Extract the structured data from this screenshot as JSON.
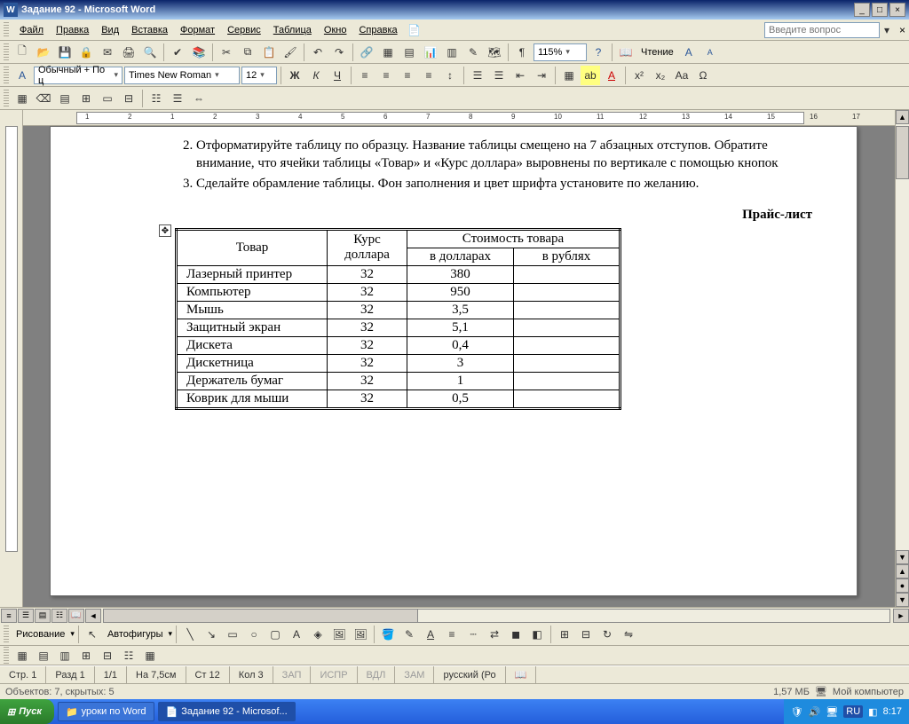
{
  "window": {
    "title": "Задание 92 - Microsoft Word"
  },
  "menu": {
    "items": [
      "Файл",
      "Правка",
      "Вид",
      "Вставка",
      "Формат",
      "Сервис",
      "Таблица",
      "Окно",
      "Справка"
    ],
    "help_placeholder": "Введите вопрос"
  },
  "formatting": {
    "style": "Обычный + По ц",
    "font": "Times New Roman",
    "size": "12",
    "zoom": "115%",
    "reading": "Чтение"
  },
  "drawing": {
    "label": "Рисование",
    "autoshapes": "Автофигуры"
  },
  "ruler_ticks": [
    "1",
    "2",
    "1",
    "2",
    "3",
    "4",
    "5",
    "6",
    "7",
    "8",
    "9",
    "10",
    "11",
    "12",
    "13",
    "14",
    "15",
    "16",
    "17"
  ],
  "document": {
    "list": [
      "Отформатируйте таблицу по образцу. Название таблицы смещено на 7 абзацных отступов. Обратите внимание, что ячейки таблицы «Товар» и «Курс доллара» выровнены по вертикале с помощью кнопок",
      "Сделайте обрамление таблицы. Фон заполнения и цвет шрифта установите по желанию."
    ],
    "heading": "Прайс-лист",
    "table": {
      "h_tovar": "Товар",
      "h_kurs": "Курс доллара",
      "h_stoim": "Стоимость товара",
      "h_usd": "в долларах",
      "h_rub": "в рублях",
      "rows": [
        {
          "name": "Лазерный принтер",
          "rate": "32",
          "usd": "380",
          "rub": ""
        },
        {
          "name": "Компьютер",
          "rate": "32",
          "usd": "950",
          "rub": ""
        },
        {
          "name": "Мышь",
          "rate": "32",
          "usd": "3,5",
          "rub": ""
        },
        {
          "name": "Защитный экран",
          "rate": "32",
          "usd": "5,1",
          "rub": ""
        },
        {
          "name": "Дискета",
          "rate": "32",
          "usd": "0,4",
          "rub": ""
        },
        {
          "name": "Дискетница",
          "rate": "32",
          "usd": "3",
          "rub": ""
        },
        {
          "name": "Держатель бумаг",
          "rate": "32",
          "usd": "1",
          "rub": ""
        },
        {
          "name": "Коврик для мыши",
          "rate": "32",
          "usd": "0,5",
          "rub": ""
        }
      ]
    }
  },
  "status": {
    "page": "Стр. 1",
    "section": "Разд 1",
    "pages": "1/1",
    "at": "На 7,5см",
    "line": "Ст 12",
    "col": "Кол 3",
    "zap": "ЗАП",
    "ispr": "ИСПР",
    "vdl": "ВДЛ",
    "zam": "ЗАМ",
    "lang": "русский (Ро"
  },
  "objects_bar": {
    "text": "Объектов: 7, скрытых: 5",
    "size": "1,57 МБ",
    "computer": "Мой компьютер"
  },
  "taskbar": {
    "start": "Пуск",
    "items": [
      "уроки по Word",
      "Задание 92 - Microsof..."
    ],
    "lang": "RU",
    "time": "8:17"
  }
}
